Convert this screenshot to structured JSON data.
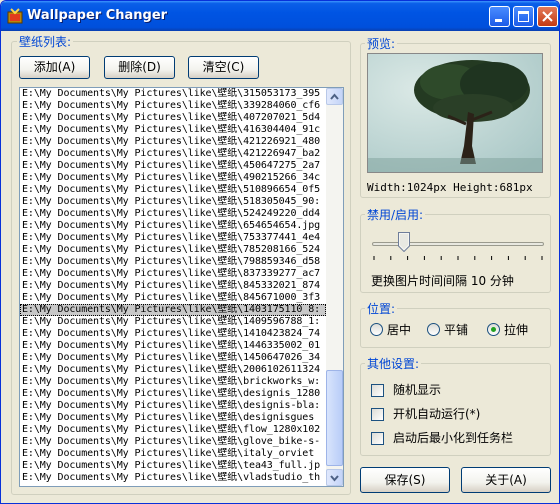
{
  "window": {
    "title": "Wallpaper Changer"
  },
  "list_panel": {
    "label": "壁纸列表:",
    "add_label": "添加(A)",
    "delete_label": "删除(D)",
    "clear_label": "清空(C)",
    "files": [
      "E:\\My Documents\\My Pictures\\like\\壁纸\\315053173_395",
      "E:\\My Documents\\My Pictures\\like\\壁纸\\339284060_cf6",
      "E:\\My Documents\\My Pictures\\like\\壁纸\\407207021_5d4",
      "E:\\My Documents\\My Pictures\\like\\壁纸\\416304404_91c",
      "E:\\My Documents\\My Pictures\\like\\壁纸\\421226921_480",
      "E:\\My Documents\\My Pictures\\like\\壁纸\\421226947_ba2",
      "E:\\My Documents\\My Pictures\\like\\壁纸\\450647275_2a7",
      "E:\\My Documents\\My Pictures\\like\\壁纸\\490215266_34c",
      "E:\\My Documents\\My Pictures\\like\\壁纸\\510896654_0f5",
      "E:\\My Documents\\My Pictures\\like\\壁纸\\518305045_90:",
      "E:\\My Documents\\My Pictures\\like\\壁纸\\524249220_dd4",
      "E:\\My Documents\\My Pictures\\like\\壁纸\\654654654.jpg",
      "E:\\My Documents\\My Pictures\\like\\壁纸\\753377441_4e4",
      "E:\\My Documents\\My Pictures\\like\\壁纸\\785208166_524",
      "E:\\My Documents\\My Pictures\\like\\壁纸\\798859346_d58",
      "E:\\My Documents\\My Pictures\\like\\壁纸\\837339277_ac7",
      "E:\\My Documents\\My Pictures\\like\\壁纸\\845332021_874",
      "E:\\My Documents\\My Pictures\\like\\壁纸\\845671000_3f3",
      "E:\\My Documents\\My Pictures\\like\\壁纸\\1403175110_8:",
      "E:\\My Documents\\My Pictures\\like\\壁纸\\1409596788_1:",
      "E:\\My Documents\\My Pictures\\like\\壁纸\\1410423824_74",
      "E:\\My Documents\\My Pictures\\like\\壁纸\\1446335002_01",
      "E:\\My Documents\\My Pictures\\like\\壁纸\\1450647026_34",
      "E:\\My Documents\\My Pictures\\like\\壁纸\\2006102611324",
      "E:\\My Documents\\My Pictures\\like\\壁纸\\brickworks_w:",
      "E:\\My Documents\\My Pictures\\like\\壁纸\\designis_1280",
      "E:\\My Documents\\My Pictures\\like\\壁纸\\designis-bla:",
      "E:\\My Documents\\My Pictures\\like\\壁纸\\designisgues",
      "E:\\My Documents\\My Pictures\\like\\壁纸\\flow_1280x102",
      "E:\\My Documents\\My Pictures\\like\\壁纸\\glove_bike-s-",
      "E:\\My Documents\\My Pictures\\like\\壁纸\\italy_orviet",
      "E:\\My Documents\\My Pictures\\like\\壁纸\\tea43_full.jp",
      "E:\\My Documents\\My Pictures\\like\\壁纸\\vladstudio_th"
    ],
    "selected_index": 18
  },
  "preview": {
    "label": "预览:",
    "dimensions": "Width:1024px Height:681px"
  },
  "enable": {
    "label": "禁用/启用:",
    "interval_text": "更换图片时间间隔 10 分钟",
    "slider_fraction": 0.18
  },
  "position": {
    "label": "位置:",
    "options": [
      "居中",
      "平铺",
      "拉伸"
    ],
    "selected": "拉伸"
  },
  "other": {
    "label": "其他设置:",
    "options": [
      "随机显示",
      "开机自动运行(*)",
      "启动后最小化到任务栏"
    ],
    "checked": [
      false,
      false,
      false
    ]
  },
  "footer": {
    "save_label": "保存(S)",
    "about_label": "关于(A)"
  },
  "colors": {
    "title_bar": "#0054e3",
    "group_label": "#0046d5",
    "face": "#ece9d8",
    "selected_row": "#c8c8c8"
  }
}
